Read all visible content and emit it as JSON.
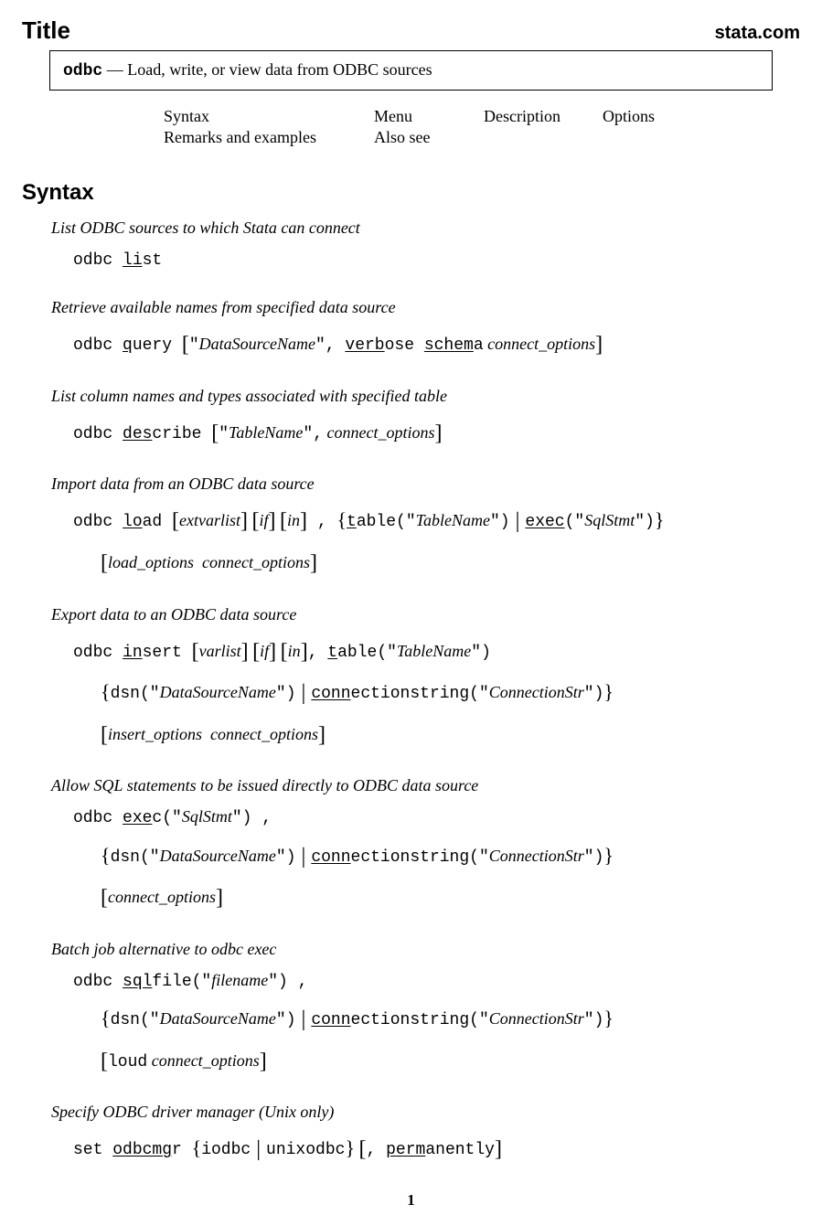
{
  "header": {
    "title": "Title",
    "site": "stata.com"
  },
  "titlebox": {
    "cmd": "odbc",
    "sep": " — ",
    "desc": "Load, write, or view data from ODBC sources"
  },
  "nav": {
    "r1c1": "Syntax",
    "r1c2": "Menu",
    "r1c3": "Description",
    "r1c4": "Options",
    "r2c1": "Remarks and examples",
    "r2c2": "Also see"
  },
  "section_syntax": "Syntax",
  "s1": {
    "desc": "List ODBC sources to which Stata can connect"
  },
  "s2": {
    "desc": "Retrieve available names from specified data source"
  },
  "s3": {
    "desc": "List column names and types associated with specified table"
  },
  "s4": {
    "desc": "Import data from an ODBC data source"
  },
  "s5": {
    "desc": "Export data to an ODBC data source"
  },
  "s6": {
    "desc": "Allow SQL statements to be issued directly to ODBC data source"
  },
  "s7": {
    "desc": "Batch job alternative to odbc exec"
  },
  "s8": {
    "desc": "Specify ODBC driver manager (Unix only)"
  },
  "page": "1"
}
